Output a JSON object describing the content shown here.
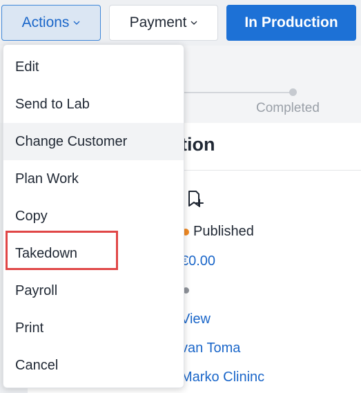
{
  "toolbar": {
    "actions_label": "Actions",
    "payment_label": "Payment",
    "production_label": "In Production"
  },
  "progress": {
    "step_label": "Completed"
  },
  "details": {
    "title_fragment": "tion",
    "status_label": "Published",
    "amount_fragment": "€0.00",
    "view_fragment": "View",
    "person_fragment": "van Toma",
    "clinic_fragment": "Marko Clininc"
  },
  "menu": {
    "items": [
      {
        "label": "Edit"
      },
      {
        "label": "Send to Lab"
      },
      {
        "label": "Change Customer"
      },
      {
        "label": "Plan Work"
      },
      {
        "label": "Copy"
      },
      {
        "label": "Takedown"
      },
      {
        "label": "Payroll"
      },
      {
        "label": "Print"
      },
      {
        "label": "Cancel"
      }
    ],
    "hovered_item": "Change Customer",
    "highlighted_item": "Takedown"
  },
  "icons": {
    "dropdown": "chevron-down-icon",
    "document_add": "document-plus-icon"
  },
  "colors": {
    "accent": "#1d71d6",
    "status_published": "#f08a24",
    "highlight_border": "#e04646"
  }
}
